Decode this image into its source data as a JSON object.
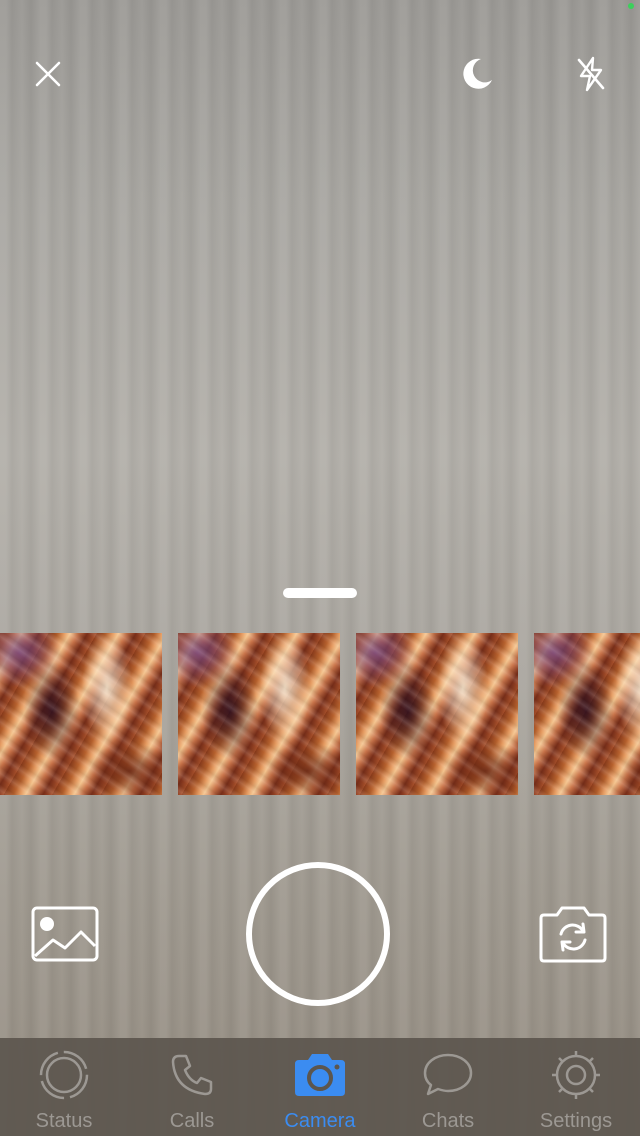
{
  "camera": {
    "top_controls": {
      "close_icon": "close-icon",
      "night_mode_icon": "moon-icon",
      "flash_icon": "flash-off-icon"
    },
    "recent_photos_count": 4,
    "bottom_controls": {
      "gallery_icon": "image-gallery-icon",
      "shutter_icon": "shutter-circle",
      "flip_camera_icon": "camera-flip-icon"
    }
  },
  "tabbar": {
    "tabs": [
      {
        "label": "Status",
        "icon": "status-ring-icon",
        "active": false
      },
      {
        "label": "Calls",
        "icon": "phone-icon",
        "active": false
      },
      {
        "label": "Camera",
        "icon": "camera-icon",
        "active": true
      },
      {
        "label": "Chats",
        "icon": "chat-bubble-icon",
        "active": false
      },
      {
        "label": "Settings",
        "icon": "gear-icon",
        "active": false
      }
    ],
    "active_color": "#3b8cf1",
    "inactive_color": "#9c9893"
  }
}
